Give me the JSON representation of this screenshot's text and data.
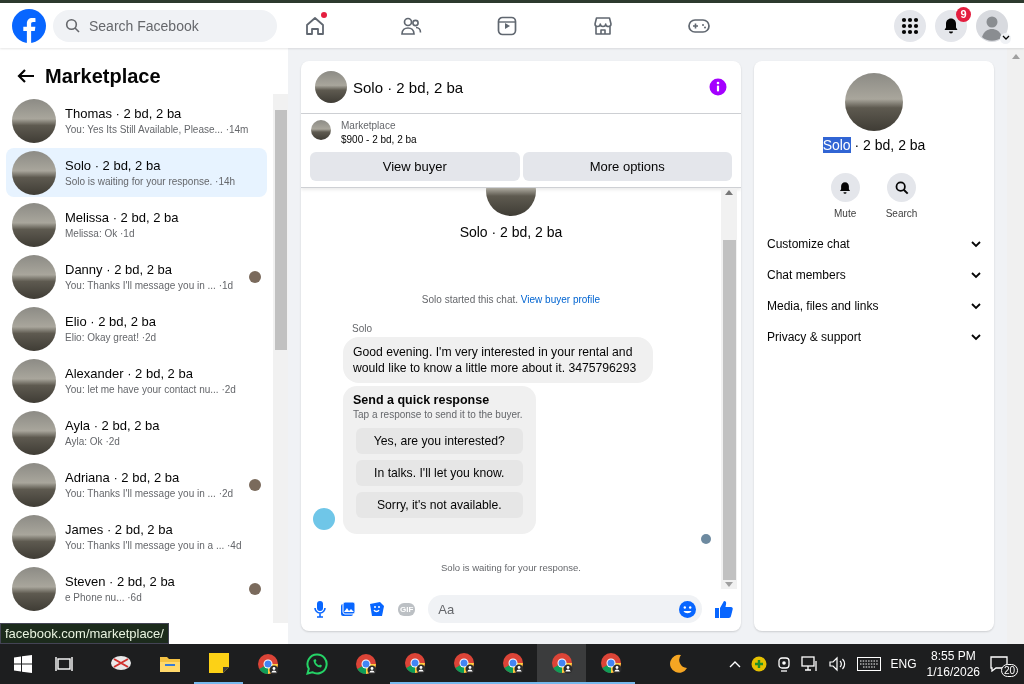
{
  "header": {
    "search": {
      "placeholder": "Search Facebook"
    },
    "nav": [
      {
        "kind": "home",
        "dot": true
      },
      {
        "kind": "friends",
        "dot": false
      },
      {
        "kind": "watch",
        "dot": false
      },
      {
        "kind": "marketplace",
        "dot": false
      },
      {
        "kind": "gaming",
        "dot": false
      }
    ],
    "notifications_badge": "9"
  },
  "sidebar": {
    "title": "Marketplace",
    "conversations": [
      {
        "name": "Thomas · 2 bd, 2 ba",
        "preview": "You: Yes Its Still Available, Please...",
        "time": "·14m",
        "selected": false,
        "seen": false
      },
      {
        "name": "Solo · 2 bd, 2 ba",
        "preview": "Solo is waiting for your response.",
        "time": "·14h",
        "selected": true,
        "seen": false
      },
      {
        "name": "Melissa · 2 bd, 2 ba",
        "preview": "Melissa: Ok",
        "time": "·1d",
        "selected": false,
        "seen": false
      },
      {
        "name": "Danny · 2 bd, 2 ba",
        "preview": "You: Thanks I'll message you in ...",
        "time": "·1d",
        "selected": false,
        "seen": true
      },
      {
        "name": "Elio · 2 bd, 2 ba",
        "preview": "Elio: Okay great!",
        "time": "·2d",
        "selected": false,
        "seen": false
      },
      {
        "name": "Alexander · 2 bd, 2 ba",
        "preview": "You: let me have your contact nu...",
        "time": "·2d",
        "selected": false,
        "seen": false
      },
      {
        "name": "Ayla · 2 bd, 2 ba",
        "preview": "Ayla: Ok",
        "time": "·2d",
        "selected": false,
        "seen": false
      },
      {
        "name": "Adriana · 2 bd, 2 ba",
        "preview": "You: Thanks I'll message you in ...",
        "time": "·2d",
        "selected": false,
        "seen": true
      },
      {
        "name": "James · 2 bd, 2 ba",
        "preview": "You: Thanks I'll message you in a ...",
        "time": "·4d",
        "selected": false,
        "seen": false
      },
      {
        "name": "Steven · 2 bd, 2 ba",
        "preview": "e Phone nu...",
        "time": "·6d",
        "selected": false,
        "seen": true
      }
    ],
    "status_url": "facebook.com/marketplace/"
  },
  "chat": {
    "title": "Solo · 2 bd, 2 ba",
    "listing": {
      "label": "Marketplace",
      "detail": "$900 - 2 bd, 2 ba"
    },
    "buttons": [
      "View buyer",
      "More options"
    ],
    "profile_name": "Solo · 2 bd, 2 ba",
    "started_text": "Solo started this chat.",
    "started_link": "View buyer profile",
    "sender": "Solo",
    "message": "Good evening. I'm very interested in your rental and would like to know a little more about it. 3475796293",
    "quick_response": {
      "title": "Send a quick response",
      "subtitle": "Tap a response to send it to the buyer.",
      "options": [
        "Yes, are you interested?",
        "In talks. I'll let you know.",
        "Sorry, it's not available."
      ]
    },
    "waiting": "Solo is waiting for your response.",
    "composer": {
      "gif_label": "GIF",
      "placeholder": "Aa"
    }
  },
  "info_panel": {
    "name_selected": "Solo",
    "name_rest": "· 2 bd, 2 ba",
    "actions": [
      {
        "kind": "mute",
        "label": "Mute"
      },
      {
        "kind": "search",
        "label": "Search"
      }
    ],
    "sections": [
      {
        "label": "Customize chat",
        "expanded": false
      },
      {
        "label": "Chat members",
        "expanded": false
      },
      {
        "label": "Media, files and links",
        "expanded": false
      },
      {
        "label": "Privacy & support",
        "expanded": false
      }
    ]
  },
  "taskbar": {
    "apps": [
      {
        "kind": "snip",
        "running": false,
        "active": false
      },
      {
        "kind": "folder",
        "running": false,
        "active": false
      },
      {
        "kind": "notes",
        "running": true,
        "active": false
      },
      {
        "kind": "chrome",
        "running": false,
        "active": false
      },
      {
        "kind": "whatsapp",
        "running": false,
        "active": false
      },
      {
        "kind": "chrome",
        "running": false,
        "active": false
      },
      {
        "kind": "chrome",
        "running": true,
        "active": false
      },
      {
        "kind": "chrome",
        "running": true,
        "active": false
      },
      {
        "kind": "chrome",
        "running": true,
        "active": false
      },
      {
        "kind": "chrome",
        "running": true,
        "active": true
      },
      {
        "kind": "chrome",
        "running": true,
        "active": false
      }
    ],
    "language": "ENG",
    "time": "8:55 PM",
    "date": "1/16/2026",
    "notification_count": "20"
  }
}
